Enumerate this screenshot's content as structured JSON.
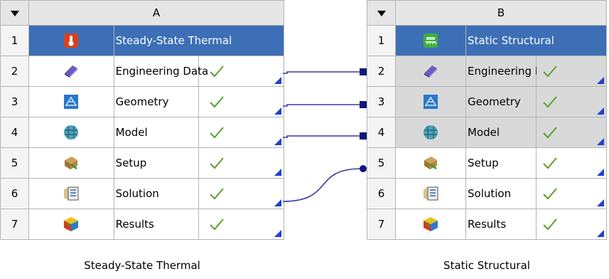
{
  "systems": [
    {
      "column": "A",
      "title": "Steady-State Thermal",
      "caption": "Steady-State Thermal",
      "cells": [
        {
          "num": "2",
          "label": "Engineering Data",
          "icon": "engineering-data-icon",
          "status": "up-to-date"
        },
        {
          "num": "3",
          "label": "Geometry",
          "icon": "geometry-icon",
          "status": "up-to-date"
        },
        {
          "num": "4",
          "label": "Model",
          "icon": "model-icon",
          "status": "up-to-date"
        },
        {
          "num": "5",
          "label": "Setup",
          "icon": "setup-icon",
          "status": "up-to-date"
        },
        {
          "num": "6",
          "label": "Solution",
          "icon": "solution-icon",
          "status": "up-to-date"
        },
        {
          "num": "7",
          "label": "Results",
          "icon": "results-icon",
          "status": "up-to-date"
        }
      ]
    },
    {
      "column": "B",
      "title": "Static Structural",
      "caption": "Static Structural",
      "cells": [
        {
          "num": "2",
          "label": "Engineering Data",
          "icon": "engineering-data-icon",
          "status": "up-to-date"
        },
        {
          "num": "3",
          "label": "Geometry",
          "icon": "geometry-icon",
          "status": "up-to-date"
        },
        {
          "num": "4",
          "label": "Model",
          "icon": "model-icon",
          "status": "up-to-date"
        },
        {
          "num": "5",
          "label": "Setup",
          "icon": "setup-icon",
          "status": "up-to-date"
        },
        {
          "num": "6",
          "label": "Solution",
          "icon": "solution-icon",
          "status": "up-to-date"
        },
        {
          "num": "7",
          "label": "Results",
          "icon": "results-icon",
          "status": "up-to-date"
        }
      ]
    }
  ],
  "title_row_num": "1",
  "colors": {
    "title_bg": "#3c6fb5",
    "link_line": "#3a3a9a",
    "check": "#5aa02c",
    "corner": "#1f3fd1"
  }
}
